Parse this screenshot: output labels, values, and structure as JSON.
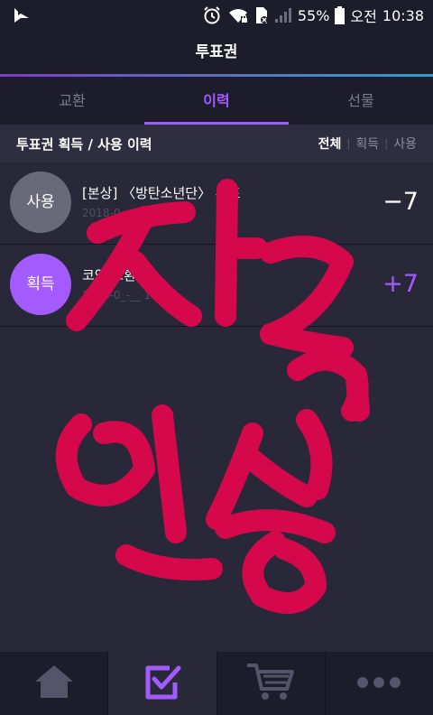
{
  "status": {
    "battery": "55%",
    "ampm": "오전",
    "time": "10:38"
  },
  "header": {
    "title": "투표권"
  },
  "tabs": [
    {
      "label": "교환"
    },
    {
      "label": "이력"
    },
    {
      "label": "선물"
    }
  ],
  "filterbar": {
    "title": "투표권 획득 / 사용 이력",
    "filters": [
      "전체",
      "획득",
      "사용"
    ]
  },
  "history": [
    {
      "badge": "사용",
      "badge_color": "#6a6979",
      "title": "[본상] 〈방탄소년단〉 투표",
      "date": "2018-0_-__ 10:38",
      "amount": "−7",
      "amount_color": "#ffffff"
    },
    {
      "badge": "획득",
      "badge_color": "#a35bff",
      "title": "코인 교환",
      "date": "2018-0_-__ 10:38",
      "amount": "+7",
      "amount_color": "#a35bff"
    }
  ],
  "nav": [
    {
      "icon": "home-icon"
    },
    {
      "icon": "vote-check-icon"
    },
    {
      "icon": "cart-icon"
    },
    {
      "icon": "more-icon"
    }
  ],
  "colors": {
    "accent": "#a35bff",
    "background": "#292839",
    "bar": "#1d1c2a",
    "scribble": "#d4084a"
  }
}
